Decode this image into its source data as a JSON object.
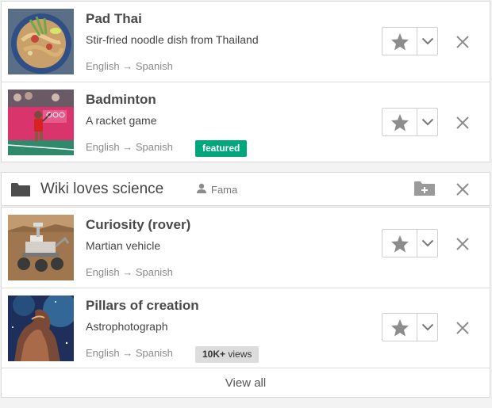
{
  "items_top": [
    {
      "title": "Pad Thai",
      "description": "Stir-fried noodle dish from Thailand",
      "languages": "English → Spanish",
      "badge": null,
      "thumbnail_icon": "pad-thai-photo"
    },
    {
      "title": "Badminton",
      "description": "A racket game",
      "languages": "English → Spanish",
      "badge": "featured",
      "thumbnail_icon": "badminton-photo"
    }
  ],
  "collection": {
    "title": "Wiki loves science",
    "owner": "Fama",
    "folder_icon": "folder-icon",
    "user_icon": "user-icon",
    "add_icon": "add-folder-icon",
    "close_icon": "close-icon"
  },
  "items_bottom": [
    {
      "title": "Curiosity (rover)",
      "description": "Martian vehicle",
      "languages": "English → Spanish",
      "badge": null,
      "thumbnail_icon": "curiosity-rover-photo"
    },
    {
      "title": "Pillars of creation",
      "description": "Astrophotograph",
      "languages": "English → Spanish",
      "badge_bold": "10K+",
      "badge_rest": " views",
      "thumbnail_icon": "nebula-photo"
    }
  ],
  "footer": {
    "view_all": "View all"
  },
  "colors": {
    "featured": "#00a77d",
    "views_badge": "#dcdcdc",
    "icon_gray": "#8c8c8c",
    "border": "#d8d8d8"
  }
}
